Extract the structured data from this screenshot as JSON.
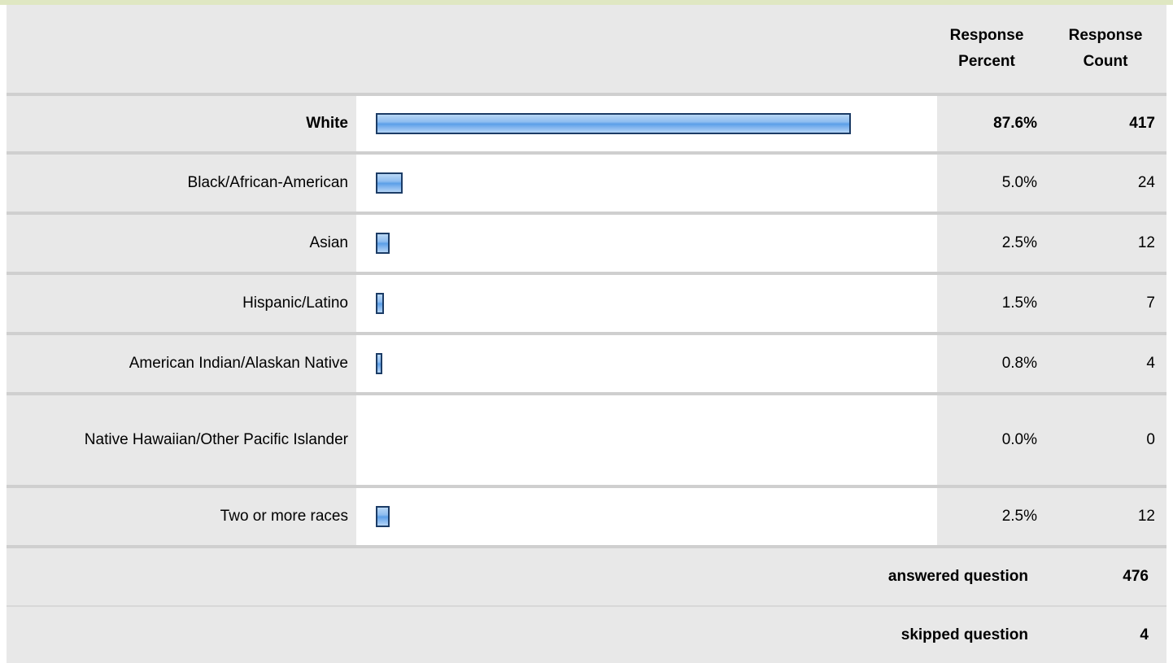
{
  "header": {
    "col_percent": "Response Percent",
    "col_count": "Response Count"
  },
  "chart_data": {
    "type": "bar",
    "categories": [
      "White",
      "Black/African-American",
      "Asian",
      "Hispanic/Latino",
      "American Indian/Alaskan Native",
      "Native Hawaiian/Other Pacific Islander",
      "Two or more races"
    ],
    "percent_labels": [
      "87.6%",
      "5.0%",
      "2.5%",
      "1.5%",
      "0.8%",
      "0.0%",
      "2.5%"
    ],
    "values": [
      87.6,
      5.0,
      2.5,
      1.5,
      0.8,
      0.0,
      2.5
    ],
    "counts": [
      "417",
      "24",
      "12",
      "7",
      "4",
      "0",
      "12"
    ],
    "xlim": [
      0,
      100
    ]
  },
  "footer": {
    "answered_label": "answered question",
    "answered_value": "476",
    "skipped_label": "skipped question",
    "skipped_value": "4"
  },
  "colors": {
    "header_bg": "#e8e8e8",
    "bar_border": "#1c3c66",
    "bar_fill": "#5b9fe8",
    "top_accent": "#dfe7c2"
  }
}
